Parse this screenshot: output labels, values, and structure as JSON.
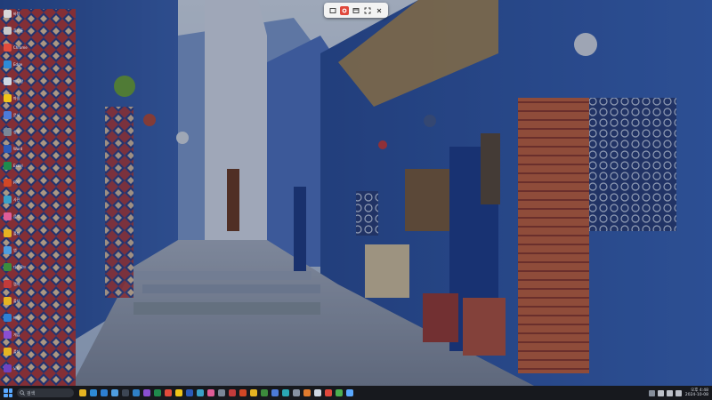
{
  "desktop": {
    "wallpaper": {
      "colors": {
        "wall_blue": "#3a63b7",
        "wall_dark": "#23407f",
        "sky": "#c9d6e8",
        "rug_red": "#b5403a",
        "rug_orange": "#c8683f",
        "street": "#8b95a8",
        "pot_green": "#6ba23a"
      }
    },
    "icons": [
      {
        "label": "바탕",
        "color": "#d9d9d9"
      },
      {
        "label": "휴지통",
        "color": "#c9c9c9"
      },
      {
        "label": "Chrome",
        "color": "#e14b3b"
      },
      {
        "label": "Edge",
        "color": "#2e8bd6"
      },
      {
        "label": "메모장",
        "color": "#cfd8e3"
      },
      {
        "label": "파일",
        "color": "#f0c419"
      },
      {
        "label": "문서",
        "color": "#4c7bd9"
      },
      {
        "label": "설정",
        "color": "#7b8797"
      },
      {
        "label": "Word",
        "color": "#2b5ab8"
      },
      {
        "label": "Excel",
        "color": "#1f8a4c"
      },
      {
        "label": "PPT",
        "color": "#d24726"
      },
      {
        "label": "사진",
        "color": "#3aa0c8"
      },
      {
        "label": "음악",
        "color": "#e05c97"
      },
      {
        "label": "폴더",
        "color": "#e6b422"
      },
      {
        "label": "앱",
        "color": "#4e9de0"
      },
      {
        "label": "다운로드",
        "color": "#3c8b3c"
      },
      {
        "label": "캡처",
        "color": "#c23b3b"
      },
      {
        "label": "폴더",
        "color": "#e6b422"
      },
      {
        "label": "메일",
        "color": "#2d7fd3"
      },
      {
        "label": "게임",
        "color": "#8a4fd1"
      },
      {
        "label": "폴더",
        "color": "#e6b422"
      },
      {
        "label": "노트",
        "color": "#6f42c1"
      }
    ]
  },
  "capture_toolbar": {
    "buttons": [
      {
        "icon": "rectangle-select-icon",
        "active": false
      },
      {
        "icon": "record-icon",
        "active": true
      },
      {
        "icon": "window-capture-icon",
        "active": false
      },
      {
        "icon": "fullscreen-capture-icon",
        "active": false
      },
      {
        "icon": "close-icon",
        "active": false
      }
    ]
  },
  "taskbar": {
    "search_placeholder": "검색",
    "apps": [
      {
        "icon": "file-explorer-icon",
        "color": "#e6b422"
      },
      {
        "icon": "browser-icon",
        "color": "#2e8bd6"
      },
      {
        "icon": "mail-icon",
        "color": "#2d7fd3"
      },
      {
        "icon": "store-icon",
        "color": "#4e9de0"
      },
      {
        "icon": "terminal-icon",
        "color": "#3d4654"
      },
      {
        "icon": "code-editor-icon",
        "color": "#2f80c7"
      },
      {
        "icon": "chat-icon",
        "color": "#8a4fd1"
      },
      {
        "icon": "spreadsheet-icon",
        "color": "#1f8a4c"
      },
      {
        "icon": "chrome-icon",
        "color": "#e14b3b"
      },
      {
        "icon": "notes-icon",
        "color": "#f0c419"
      },
      {
        "icon": "word-icon",
        "color": "#2b5ab8"
      },
      {
        "icon": "photos-icon",
        "color": "#3aa0c8"
      },
      {
        "icon": "music-icon",
        "color": "#e05c97"
      },
      {
        "icon": "settings-icon",
        "color": "#7b8797"
      },
      {
        "icon": "calendar-icon",
        "color": "#c23b3b"
      },
      {
        "icon": "video-icon",
        "color": "#d24726"
      },
      {
        "icon": "folder-icon",
        "color": "#e6b422"
      },
      {
        "icon": "green-app-icon",
        "color": "#3c8b3c"
      },
      {
        "icon": "blue-app-icon",
        "color": "#4c7bd9"
      },
      {
        "icon": "cyan-app-icon",
        "color": "#2aa7b5"
      },
      {
        "icon": "gray-app-icon",
        "color": "#8893a3"
      },
      {
        "icon": "orange-app-icon",
        "color": "#e07b2e"
      },
      {
        "icon": "white-app-icon",
        "color": "#cfd8e3"
      },
      {
        "icon": "recorder-icon",
        "color": "#e0483c"
      },
      {
        "icon": "green-app-2-icon",
        "color": "#4caf50"
      },
      {
        "icon": "sky-app-icon",
        "color": "#5aa9ff"
      }
    ],
    "tray": [
      {
        "icon": "chevron-up-icon",
        "color": "#9aa3b0"
      },
      {
        "icon": "network-icon",
        "color": "#d9dee6"
      },
      {
        "icon": "volume-icon",
        "color": "#d9dee6"
      },
      {
        "icon": "battery-icon",
        "color": "#d9dee6"
      }
    ],
    "clock": {
      "time": "오후 4:48",
      "date": "2024-10-08"
    }
  }
}
